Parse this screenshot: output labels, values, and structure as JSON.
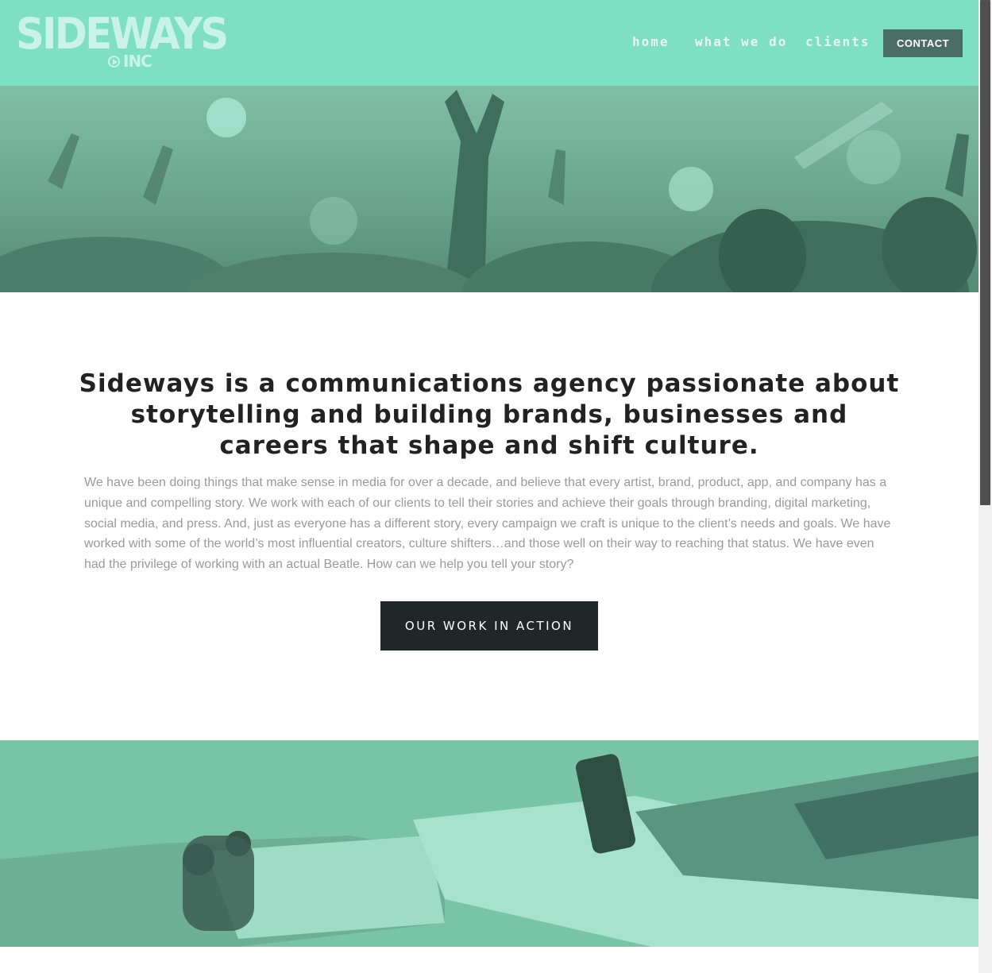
{
  "header": {
    "logo_text": "SIDEWAYS",
    "logo_sub": "INC",
    "nav": [
      {
        "label": "home"
      },
      {
        "label": "what we do"
      },
      {
        "label": "clients"
      }
    ],
    "contact_label": "CONTACT",
    "background_color": "#7fdfc3",
    "contact_color": "#4a6d66"
  },
  "hero_top": {
    "icon": "concert-crowd-image"
  },
  "main": {
    "headline": "Sideways is a communications agency passionate about storytelling and building brands, businesses and careers that shape and shift culture.",
    "body": "We have been doing things that make sense in media for over a decade, and believe that every artist, brand, product, app, and company has a unique and compelling story. We work with each of our clients to tell their stories and achieve their goals through branding, digital marketing, social media, and press. And, just as everyone has a different story, every campaign we craft is unique to the client’s needs and goals. We have worked with some of the world’s most influential creators, culture shifters…and those well on their way to reaching that status. We have even had the privilege of working with an actual Beatle. How can we help you tell your story?",
    "cta_label": "OUR WORK IN ACTION",
    "cta_color": "#212727"
  },
  "hero_bottom": {
    "icon": "fist-bump-image"
  }
}
